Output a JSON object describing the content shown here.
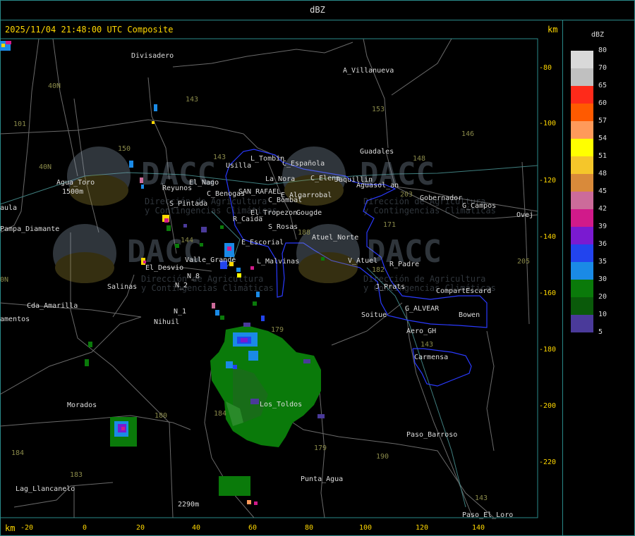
{
  "header": {
    "title": "dBZ"
  },
  "timestamp": "2025/11/04 21:48:00 UTC Composite",
  "units": {
    "top_right": "km",
    "bottom_left": "km"
  },
  "x_axis_ticks": [
    "-20",
    "0",
    "20",
    "40",
    "60",
    "80",
    "100",
    "120",
    "140"
  ],
  "y_axis_ticks": [
    "-80",
    "-100",
    "-120",
    "-140",
    "-160",
    "-180",
    "-200",
    "-220"
  ],
  "legend": {
    "title": "dBZ",
    "items": [
      {
        "label": "80",
        "color": "#d9d9d9"
      },
      {
        "label": "70",
        "color": "#c0c0c0"
      },
      {
        "label": "65",
        "color": "#ff2a1a"
      },
      {
        "label": "60",
        "color": "#ff5a00"
      },
      {
        "label": "57",
        "color": "#ff9a5a"
      },
      {
        "label": "54",
        "color": "#ffff00"
      },
      {
        "label": "51",
        "color": "#f5c62a"
      },
      {
        "label": "48",
        "color": "#d98a3a"
      },
      {
        "label": "45",
        "color": "#cc6b9a"
      },
      {
        "label": "42",
        "color": "#d11a8a"
      },
      {
        "label": "39",
        "color": "#7a1ad1"
      },
      {
        "label": "36",
        "color": "#2244ee"
      },
      {
        "label": "35",
        "color": "#1a8ae6"
      },
      {
        "label": "30",
        "color": "#0a7a0a"
      },
      {
        "label": "20",
        "color": "#0a5a0a"
      },
      {
        "label": "10",
        "color": "#4a3a9a"
      },
      {
        "label": "5",
        "color": ""
      }
    ]
  },
  "places": [
    "Divisadero",
    "A_Villanueva",
    "Guadales",
    "Usilla",
    "L_Tombin",
    "C_Española",
    "C_Elena",
    "Jaquillin",
    "Aguasol_an",
    "Gobernador",
    "G_Campos",
    "Ovej",
    "Agua_Toro",
    "Reyunos",
    "El_Nago",
    "C_Benogas",
    "SAN_RAFAEL",
    "La_Nora",
    "E_Algarrobal",
    "C_Bombal",
    "R_Caida",
    "El_Tropezon",
    "Gougde",
    "S_Rosas",
    "Atuel_Norte",
    "E_Escorial",
    "S_Pintada",
    "Pampa_Diamante",
    "aula",
    "El_Desvio",
    "Valle_Grande",
    "L_Malvinas",
    "V_Atuel",
    "R_Padre",
    "J_Prats",
    "CompartEscard",
    "G_ALVEAR",
    "Bowen",
    "Soitue",
    "Aero_GH",
    "Salinas",
    "N_2",
    "N_8",
    "N_1",
    "Cda_Amarilla",
    "amentos",
    "Nihuil",
    "Carmensa",
    "Morados",
    "Los_Toldos",
    "Paso_Barroso",
    "Punta_Agua",
    "Lag_Llancanelo",
    "Paso_El_Loro",
    "2290m",
    "1500m"
  ],
  "route_numbers": [
    "143",
    "153",
    "146",
    "148",
    "150",
    "101",
    "40N",
    "143",
    "171",
    "203",
    "144",
    "182",
    "188",
    "205",
    "179",
    "180",
    "184",
    "179",
    "190",
    "183",
    "184",
    "143",
    "143",
    "0N",
    "40N"
  ],
  "watermarks": {
    "brand": "DACC",
    "line1": "Dirección de Agricultura",
    "line2": "y Contingencias Climáticas"
  },
  "colors": {
    "accent": "#ffd800",
    "frame": "#2a8a8a",
    "county_lines": "#7a7a7a",
    "highlight_region": "#2a3aff"
  }
}
